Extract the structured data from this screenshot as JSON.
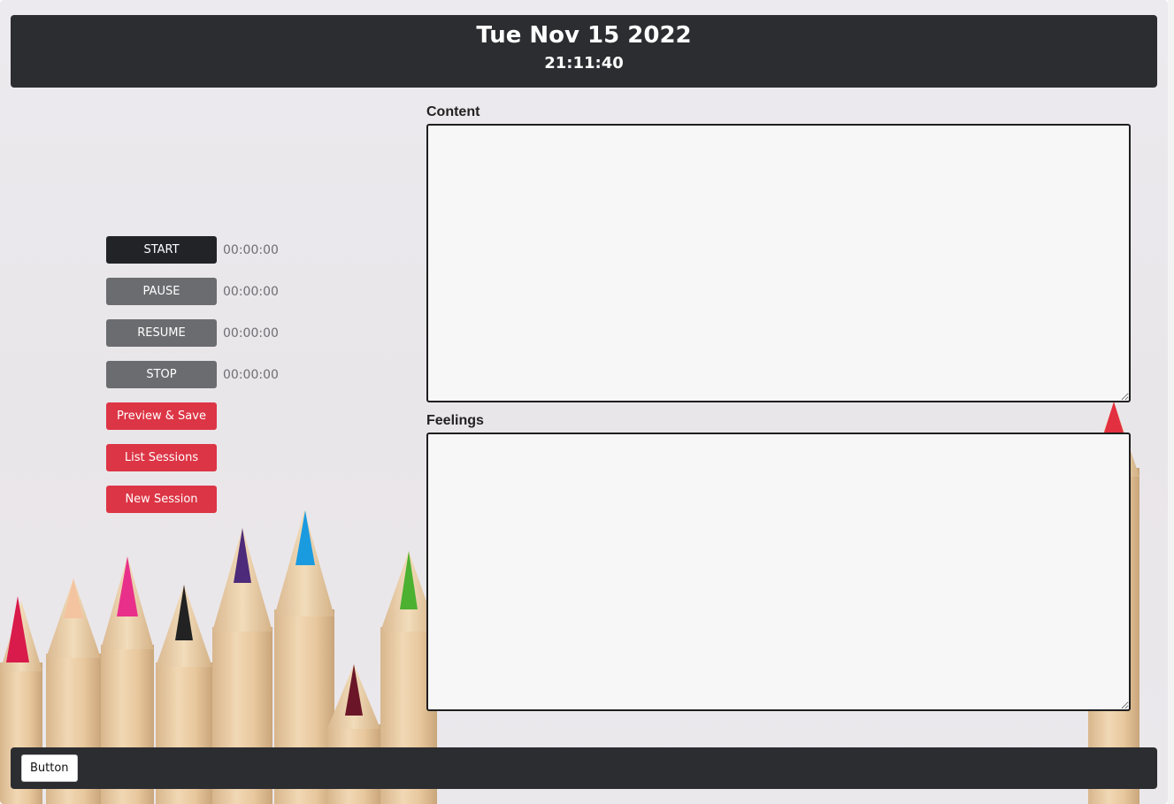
{
  "header": {
    "date": "Tue Nov 15 2022",
    "time": "21:11:40"
  },
  "controls": {
    "start": {
      "label": "START",
      "timer": "00:00:00"
    },
    "pause": {
      "label": "PAUSE",
      "timer": "00:00:00"
    },
    "resume": {
      "label": "RESUME",
      "timer": "00:00:00"
    },
    "stop": {
      "label": "STOP",
      "timer": "00:00:00"
    },
    "preview_save": "Preview & Save",
    "list_sessions": "List Sessions",
    "new_session": "New Session"
  },
  "content": {
    "label": "Content",
    "value": ""
  },
  "feelings": {
    "label": "Feelings",
    "value": ""
  },
  "footer": {
    "button_label": "Button"
  },
  "colors": {
    "header_bg": "#2c2d31",
    "start_btn": "#212327",
    "secondary_btn": "#6a6c70",
    "danger_btn": "#dc3545"
  }
}
